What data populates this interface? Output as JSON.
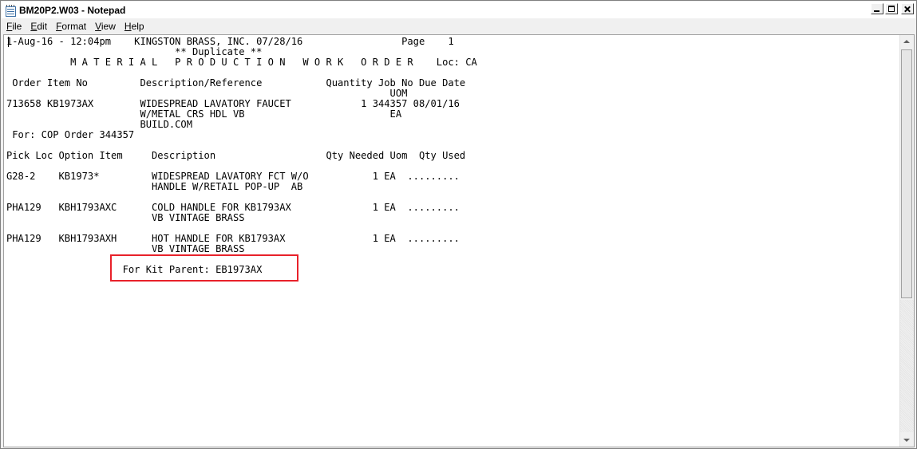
{
  "window": {
    "title": "BM20P2.W03 - Notepad"
  },
  "menu": [
    {
      "accel": "F",
      "rest": "ile"
    },
    {
      "accel": "E",
      "rest": "dit"
    },
    {
      "accel": "F",
      "rest": "ormat",
      "pre": ""
    },
    {
      "accel": "V",
      "rest": "iew"
    },
    {
      "accel": "H",
      "rest": "elp"
    }
  ],
  "document": {
    "header": {
      "line1": "1-Aug-16 - 12:04pm    KINGSTON BRASS, INC. 07/28/16                 Page    1",
      "line2": "                             ** Duplicate **",
      "line3": "           M A T E R I A L   P R O D U C T I O N   W O R K   O R D E R    Loc: CA"
    },
    "order_section": {
      "column_header": " Order Item No         Description/Reference           Quantity Job No Due Date",
      "uom_header": "                                                                  UOM",
      "row_line1": "713658 KB1973AX        WIDESPREAD LAVATORY FAUCET            1 344357 08/01/16",
      "row_line2": "                       W/METAL CRS HDL VB                         EA",
      "row_line3": "                       BUILD.COM",
      "for_line": " For: COP Order 344357"
    },
    "pick_section": {
      "column_header": "Pick Loc Option Item     Description                   Qty Needed Uom  Qty Used",
      "items": [
        {
          "line1": "G28-2    KB1973*         WIDESPREAD LAVATORY FCT W/O           1 EA  .........",
          "line2": "                         HANDLE W/RETAIL POP-UP  AB"
        },
        {
          "line1": "PHA129   KBH1793AXC      COLD HANDLE FOR KB1793AX              1 EA  .........",
          "line2": "                         VB VINTAGE BRASS"
        },
        {
          "line1": "PHA129   KBH1793AXH      HOT HANDLE FOR KB1793AX               1 EA  .........",
          "line2": "                         VB VINTAGE BRASS"
        }
      ],
      "kit_parent": "                    For Kit Parent: EB1973AX"
    }
  },
  "colors": {
    "highlight_border": "#e8212a",
    "editor_background": "#ffffff"
  }
}
